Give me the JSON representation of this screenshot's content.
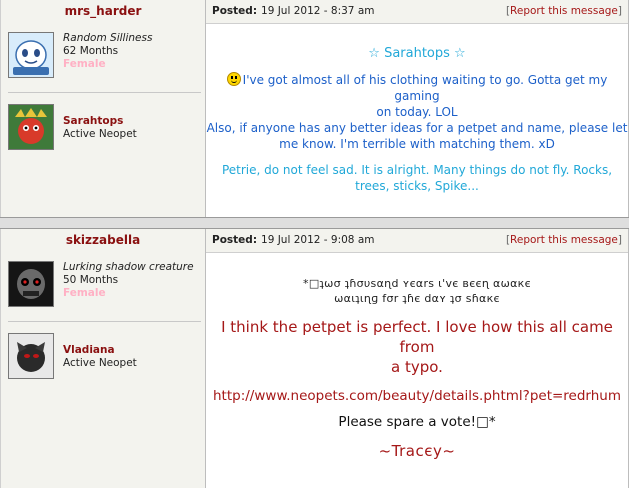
{
  "posts": [
    {
      "username": "mrs_harder",
      "title": "Random Silliness",
      "months": "62 Months",
      "gender": "Female",
      "pet_name": "Sarahtops",
      "pet_status": "Active Neopet",
      "posted_label": "Posted:",
      "posted_date": "19 Jul 2012 - 8:37 am",
      "report_open": "[",
      "report_label": "Report this message",
      "report_close": "]",
      "heading": "☆ Sarahtops ☆",
      "line1": "I've got almost all of his clothing waiting to go. Gotta get my gaming",
      "line2": "on today. LOL",
      "line3": "Also, if anyone has any better ideas for a petpet and name, please let",
      "line4": "me know. I'm terrible with matching them. xD",
      "line5": "Petrie, do not feel sad. It is alright. Many things do not fly. Rocks,",
      "line6": "trees, sticks, Spike..."
    },
    {
      "username": "skizzabella",
      "title": "Lurking shadow creature",
      "months": "50 Months",
      "gender": "Female",
      "pet_name": "Vladiana",
      "pet_status": "Active Neopet",
      "posted_label": "Posted:",
      "posted_date": "19 Jul 2012 - 9:08 am",
      "report_open": "[",
      "report_label": "Report this message",
      "report_close": "]",
      "quote1": "*□ʇωσ ʇɦσυsαɳd ʏєαrs ι'vє вєєɳ αωαкє",
      "quote2": "ωαιʇιɳɡ fσr ʇɦє dαʏ ʇσ sɦαкє",
      "red1": "I think the petpet is perfect. I love how this all came from",
      "red2": "a typo.",
      "url": "http://www.neopets.com/beauty/details.phtml?pet=redrhum",
      "vote": "Please spare a vote!□*",
      "signature": "~Tracєy~"
    }
  ],
  "colors": {
    "username": "#8a1010",
    "blue_text": "#1d60c9",
    "cyan_text": "#21a8d8",
    "red_text": "#a51818",
    "female": "#ffb0c4",
    "panel_bg": "#f3f3ee"
  },
  "icons": [
    "user-avatar-shuffle",
    "pet-avatar-sarahtops",
    "user-avatar-skull",
    "pet-avatar-vladiana",
    "smiley-icon"
  ]
}
